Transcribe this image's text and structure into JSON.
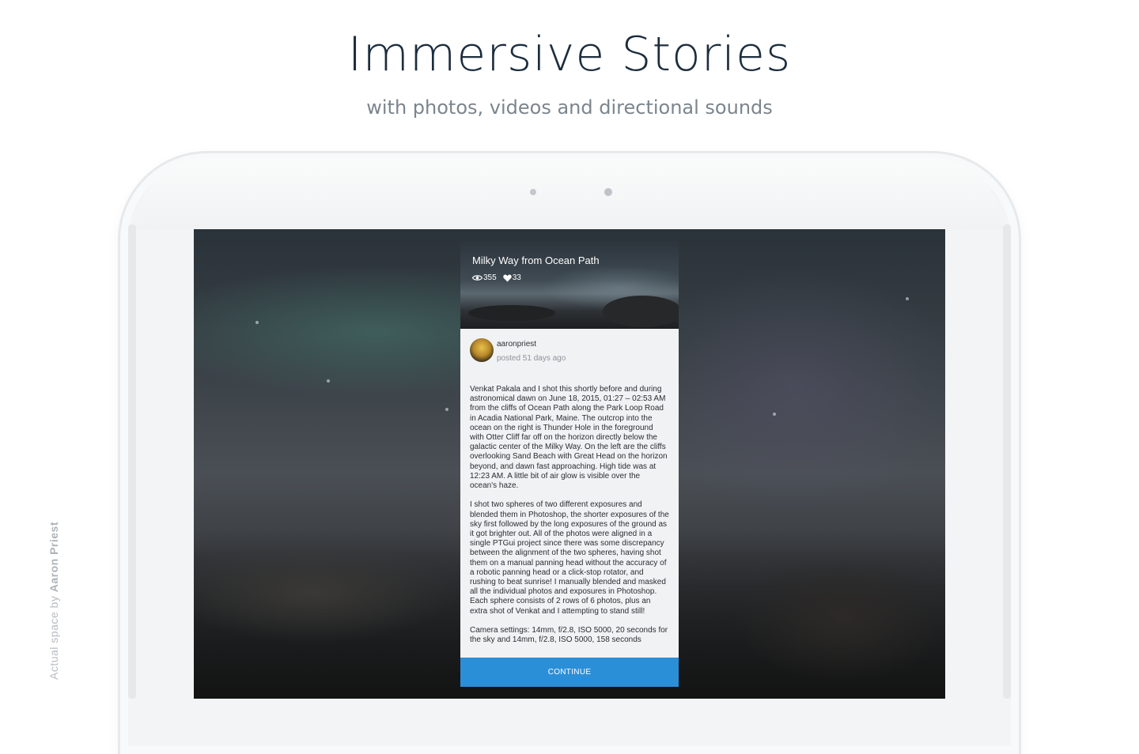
{
  "headline": "Immersive Stories",
  "subheadline": "with photos, videos and directional sounds",
  "credit": {
    "prefix": "Actual space by",
    "name": "Aaron Priest"
  },
  "story": {
    "title": "Milky Way from Ocean Path",
    "views": "355",
    "likes": "33",
    "author": "aaronpriest",
    "posted": "posted 51 days ago",
    "paragraphs": [
      "Venkat Pakala and I shot this shortly before and during astronomical dawn on June 18, 2015, 01:27 – 02:53 AM from the cliffs of Ocean Path along the Park Loop Road in Acadia National Park, Maine. The outcrop into the ocean on the right is Thunder Hole in the foreground with Otter Cliff far off on the horizon directly below the galactic center of the Milky Way. On the left are the cliffs overlooking Sand Beach with Great Head on the horizon beyond, and dawn fast approaching. High tide was at 12:23 AM. A little bit of air glow is visible over the ocean's haze.",
      "I shot two spheres of two different exposures and blended them in Photoshop, the shorter exposures of the sky first followed by the long exposures of the ground as it got brighter out. All of the photos were aligned in a single PTGui project since there was some discrepancy between the alignment of the two spheres, having shot them on a manual panning head without the accuracy of a robotic panning head or a click-stop rotator, and rushing to beat sunrise! I manually blended and masked all the individual photos and exposures in Photoshop. Each sphere consists of 2 rows of 6 photos, plus an extra shot of Venkat and I attempting to stand still!",
      "Camera settings: 14mm, f/2.8, ISO 5000, 20 seconds for the sky and 14mm, f/2.8, ISO 5000, 158 seconds"
    ],
    "continue_label": "CONTINUE"
  },
  "icons": {
    "views": "eye-icon",
    "likes": "heart-icon",
    "avatar": "user-avatar"
  },
  "colors": {
    "accent": "#2b8fd8",
    "headline": "#1c2d3d",
    "subheadline": "#7b858e"
  }
}
